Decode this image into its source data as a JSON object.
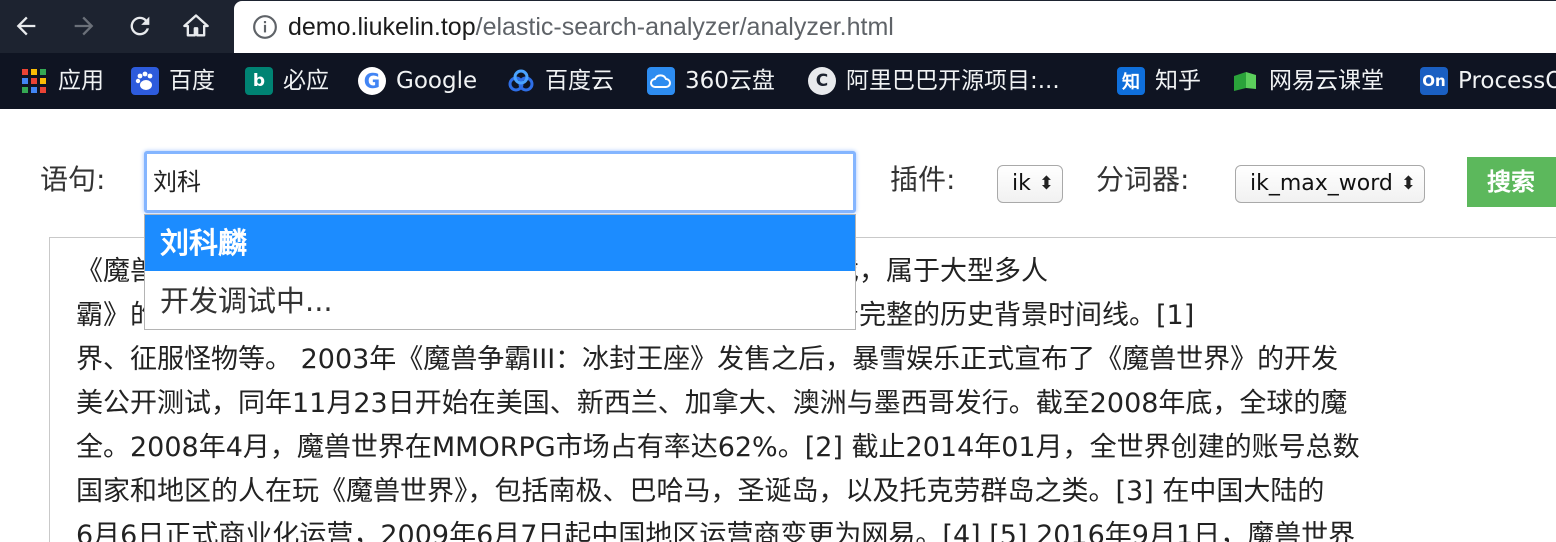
{
  "browser": {
    "url_host": "demo.liukelin.top",
    "url_path": "/elastic-search-analyzer/analyzer.html",
    "bookmarks": [
      {
        "label": "应用",
        "icon": "apps-grid-icon"
      },
      {
        "label": "百度",
        "icon": "baidu-paw-icon",
        "glyph": "",
        "color": "#2d5bdc"
      },
      {
        "label": "必应",
        "icon": "bing-icon",
        "glyph": "b",
        "color": "#008373"
      },
      {
        "label": "Google",
        "icon": "google-icon"
      },
      {
        "label": "百度云",
        "icon": "baidu-cloud-icon"
      },
      {
        "label": "360云盘",
        "icon": "360-cloud-icon",
        "glyph": "",
        "color": "#2d8cf0"
      },
      {
        "label": "阿里巴巴开源项目:...",
        "icon": "alibaba-icon",
        "glyph": "C",
        "color": "#e8eaed"
      },
      {
        "label": "知乎",
        "icon": "zhihu-icon",
        "glyph": "知",
        "color": "#0f6fdb"
      },
      {
        "label": "网易云课堂",
        "icon": "netease-study-icon",
        "glyph": "",
        "color": "#2aa33a"
      },
      {
        "label": "ProcessOn",
        "icon": "processon-icon",
        "glyph": "On",
        "color": "#1a5fc2"
      }
    ]
  },
  "form": {
    "sentence_label": "语句:",
    "sentence_value": "刘科",
    "plugin_label": "插件:",
    "plugin_value": "ik",
    "analyzer_label": "分词器:",
    "analyzer_value": "ik_max_word",
    "search_button": "搜索"
  },
  "autocomplete": {
    "items": [
      "刘科麟",
      "开发调试中..."
    ]
  },
  "content": {
    "lines": [
      "《魔兽世界》是由著名游戏公司暴雪娱乐所制作的第一款网络游戏，属于大型多人",
      "霸》的世界观为背景，玩家在游戏中扮演英雄人物，魔兽世界有着完整的历史背景时间线。[1]",
      "界、征服怪物等。 2003年《魔兽争霸III：冰封王座》发售之后，暴雪娱乐正式宣布了《魔兽世界》的开发",
      "美公开测试，同年11月23日开始在美国、新西兰、加拿大、澳洲与墨西哥发行。截至2008年底，全球的魔",
      "全。2008年4月，魔兽世界在MMORPG市场占有率达62%。[2] 截止2014年01月，全世界创建的账号总数",
      "国家和地区的人在玩《魔兽世界》，包括南极、巴哈马，圣诞岛，以及托克劳群岛之类。[3] 在中国大陆的",
      "6月6日正式商业化运营，2009年6月7日起中国地区运营商变更为网易。[4] [5] 2016年9月1日，魔兽世界"
    ]
  },
  "colors": {
    "accent": "#1c8cff",
    "search_button": "#5cb85c",
    "toolbar": "#1d2330"
  }
}
